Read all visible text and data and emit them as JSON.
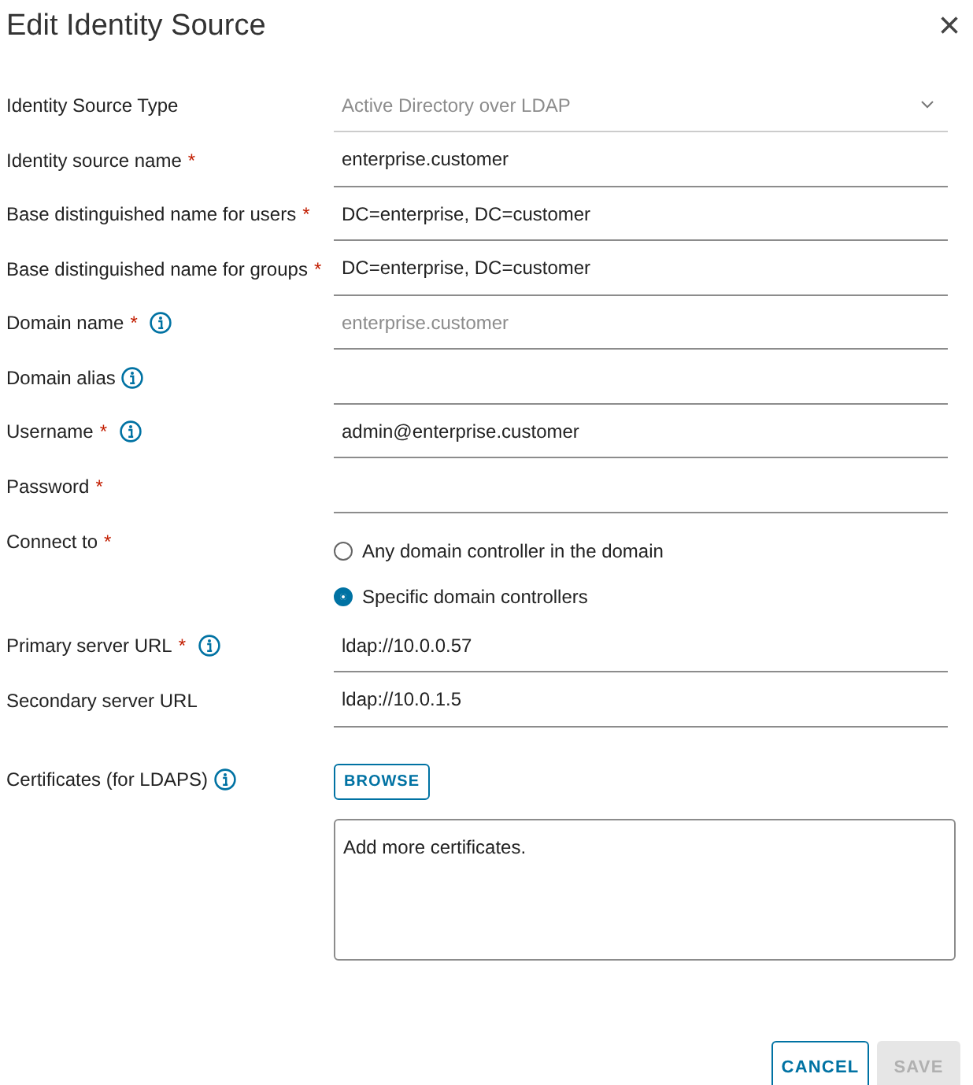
{
  "dialog": {
    "title": "Edit Identity Source",
    "close": "×"
  },
  "fields": [
    {
      "kind": "select",
      "label": "Identity Source Type",
      "info": false,
      "value": "Active Directory over LDAP",
      "disabled": true
    },
    {
      "kind": "text",
      "label": "Identity source name",
      "required_mark": "*",
      "info": false,
      "value": "enterprise.customer"
    },
    {
      "kind": "text",
      "label": "Base distinguished name for users",
      "required_mark": "*",
      "info": false,
      "value": "DC=enterprise, DC=customer"
    },
    {
      "kind": "text",
      "label": "Base distinguished name for groups",
      "required_mark": "*",
      "info": false,
      "value": "DC=enterprise, DC=customer"
    },
    {
      "kind": "text",
      "label": "Domain name",
      "required_mark": "*",
      "info": true,
      "value": "enterprise.customer",
      "disabled": true
    },
    {
      "kind": "text",
      "label": "Domain alias",
      "info": true
    },
    {
      "kind": "text",
      "label": "Username",
      "required_mark": "*",
      "info": true,
      "value": "admin@enterprise.customer"
    },
    {
      "kind": "text",
      "label": "Password",
      "required_mark": "*",
      "info": false
    },
    {
      "kind": "radio",
      "label": "Connect to",
      "required_mark": "*",
      "info": false,
      "options": [
        {
          "label": "Any domain controller in the domain",
          "selected": false
        },
        {
          "label": "Specific domain controllers",
          "selected": true
        }
      ]
    },
    {
      "kind": "text",
      "label": "Primary server URL",
      "required_mark": "*",
      "info": true,
      "value": "ldap://10.0.0.57"
    },
    {
      "kind": "text",
      "label": "Secondary server URL",
      "info": false,
      "value": "ldap://10.0.1.5"
    },
    {
      "kind": "file",
      "label": "Certificates (for LDAPS)",
      "info": true,
      "button": "BROWSE",
      "value": "Add more certificates."
    }
  ],
  "buttons": [
    {
      "label": "CANCEL",
      "disabled": false
    },
    {
      "label": "SAVE",
      "disabled": true
    }
  ]
}
